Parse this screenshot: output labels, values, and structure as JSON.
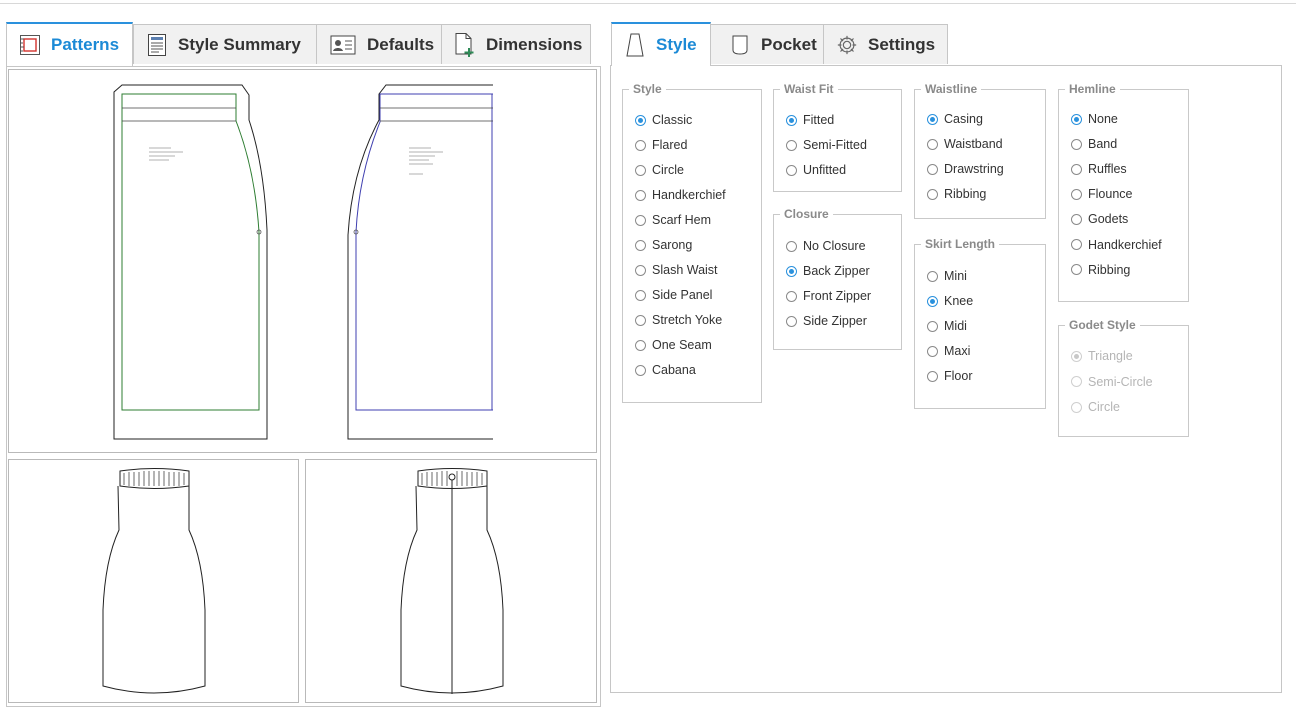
{
  "left_tabs": [
    {
      "label": "Patterns",
      "icon": "pattern-icon",
      "active": true
    },
    {
      "label": "Style Summary",
      "icon": "document-icon",
      "active": false
    },
    {
      "label": "Defaults",
      "icon": "user-card-icon",
      "active": false
    },
    {
      "label": "Dimensions",
      "icon": "add-document-icon",
      "active": false
    }
  ],
  "right_tabs": [
    {
      "label": "Style",
      "icon": "skirt-icon",
      "active": true
    },
    {
      "label": "Pocket",
      "icon": "pocket-icon",
      "active": false
    },
    {
      "label": "Settings",
      "icon": "gear-icon",
      "active": false
    }
  ],
  "colors": {
    "accent": "#2a91dd",
    "front_seam": "#2e7d32",
    "back_seam": "#3f3fb0"
  },
  "groups": {
    "style": {
      "legend": "Style",
      "selected": "Classic",
      "options": [
        "Classic",
        "Flared",
        "Circle",
        "Handkerchief",
        "Scarf Hem",
        "Sarong",
        "Slash Waist",
        "Side Panel",
        "Stretch Yoke",
        "One Seam",
        "Cabana"
      ]
    },
    "waist_fit": {
      "legend": "Waist Fit",
      "selected": "Fitted",
      "options": [
        "Fitted",
        "Semi-Fitted",
        "Unfitted"
      ]
    },
    "closure": {
      "legend": "Closure",
      "selected": "Back Zipper",
      "options": [
        "No Closure",
        "Back Zipper",
        "Front Zipper",
        "Side Zipper"
      ]
    },
    "waistline": {
      "legend": "Waistline",
      "selected": "Casing",
      "options": [
        "Casing",
        "Waistband",
        "Drawstring",
        "Ribbing"
      ]
    },
    "skirt_length": {
      "legend": "Skirt Length",
      "selected": "Knee",
      "options": [
        "Mini",
        "Knee",
        "Midi",
        "Maxi",
        "Floor"
      ]
    },
    "hemline": {
      "legend": "Hemline",
      "selected": "None",
      "options": [
        "None",
        "Band",
        "Ruffles",
        "Flounce",
        "Godets",
        "Handkerchief",
        "Ribbing"
      ]
    },
    "godet_style": {
      "legend": "Godet Style",
      "selected": "Triangle",
      "disabled": true,
      "options": [
        "Triangle",
        "Semi-Circle",
        "Circle"
      ]
    }
  }
}
